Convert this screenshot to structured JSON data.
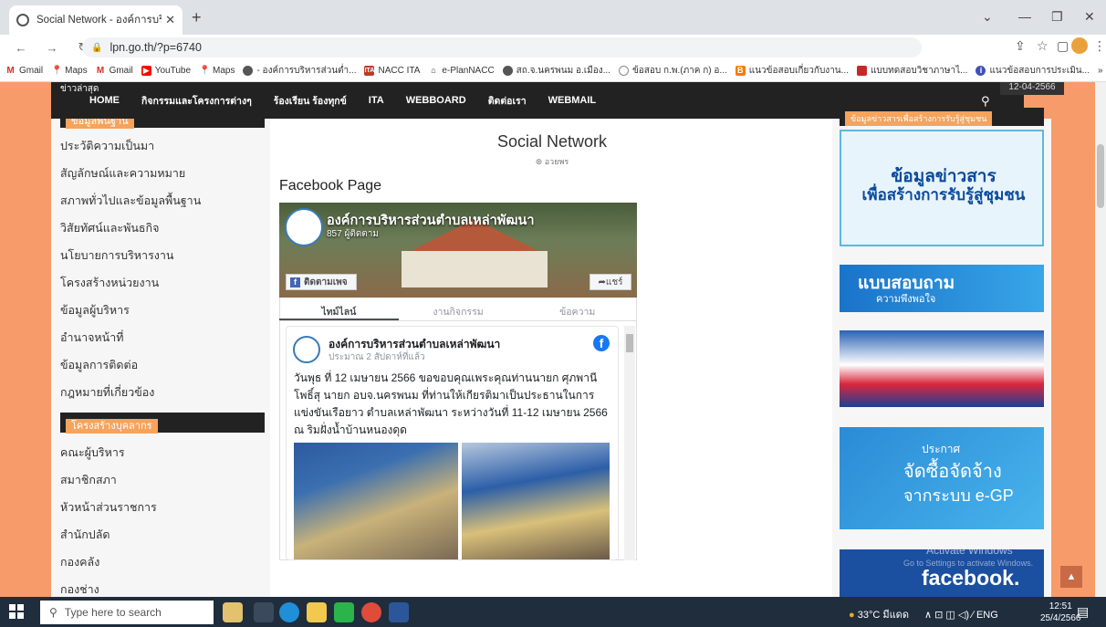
{
  "browser": {
    "tab_title": "Social Network - องค์การบริหารส่วนฯ",
    "url": "lpn.go.th/?p=6740",
    "bookmarks": [
      "Gmail",
      "Maps",
      "Gmail",
      "YouTube",
      "Maps",
      "- องค์การบริหารส่วนต่ำ...",
      "NACC ITA",
      "e-PlanNACC",
      "สถ.จ.นครพนม อ.เมือง...",
      "ข้อสอบ ก.พ.(ภาค ก) อ...",
      "แนวข้อสอบเกี่ยวกับงาน...",
      "แบบทดสอบวิชาภาษาไ...",
      "แนวข้อสอบการประเมิน..."
    ]
  },
  "site": {
    "news_label": "ข่าวล่าสุด",
    "date": "12-04-2566",
    "nav": [
      "HOME",
      "กิจกรรมและโครงการต่างๆ",
      "ร้องเรียน ร้องทุกข์",
      "ITA",
      "WEBBOARD",
      "ติดต่อเรา",
      "WEBMAIL"
    ],
    "left_section1": "ข้อมูลพื้นฐาน",
    "left_items1": [
      "ประวัติความเป็นมา",
      "สัญลักษณ์และความหมาย",
      "สภาพทั่วไปและข้อมูลพื้นฐาน",
      "วิสัยทัศน์และพันธกิจ",
      "นโยบายการบริหารงาน",
      "โครงสร้างหน่วยงาน",
      "ข้อมูลผู้บริหาร",
      "อำนาจหน้าที่",
      "ข้อมูลการติดต่อ",
      "กฎหมายที่เกี่ยวข้อง"
    ],
    "left_section2": "โครงสร้างบุคลากร",
    "left_items2": [
      "คณะผู้บริหาร",
      "สมาชิกสภา",
      "หัวหน้าส่วนราชการ",
      "สำนักปลัด",
      "กองคลัง",
      "กองช่าง"
    ],
    "page_title": "Social Network",
    "author": "อวยพร",
    "fb_heading": "Facebook Page",
    "right_heading": "ข้อมูลข่าวสารเพื่อสร้างการรับรู้สู่ชุมชน"
  },
  "fb": {
    "page_name": "องค์การบริหารส่วนตำบลเหล่าพัฒนา",
    "followers": "857 ผู้ติดตาม",
    "follow_label": "ติดตามเพจ",
    "share_label": "แชร์",
    "tabs": [
      "ไทม์ไลน์",
      "งานกิจกรรม",
      "ข้อความ"
    ],
    "post_author": "องค์การบริหารส่วนตำบลเหล่าพัฒนา",
    "post_time": "ประมาณ 2 สัปดาห์ที่แล้ว",
    "post_text": "วันพุธ ที่ 12 เมษายน 2566 ขอขอบคุณเพระคุณท่านนายก ศุภพานี โพธิ์สุ นายก อบจ.นครพนม ที่ท่านให้เกียรติมาเป็นประธานในการแข่งขันเรือยาว ตำบลเหล่าพัฒนา ระหว่างวันที่ 11-12 เมษายน 2566 ณ ริมฝั่งน้ำบ้านหนองดุด"
  },
  "banners": {
    "b1_line1": "ข้อมูลข่าวสาร",
    "b1_line2": "เพื่อสร้างการรับรู้สู่ชุมชน",
    "b2_line1": "แบบสอบถาม",
    "b2_line2": "ความพึงพอใจ",
    "b4_line1": "ประกาศ",
    "b4_line2": "จัดซื้อจัดจ้าง",
    "b4_line3": "จากระบบ e-GP",
    "b5_text": "facebook.",
    "watermark1": "Activate Windows",
    "watermark2": "Go to Settings to activate Windows."
  },
  "taskbar": {
    "search_placeholder": "Type here to search",
    "weather": "33°C มีแดด",
    "lang": "ENG",
    "time": "12:51",
    "date": "25/4/2566"
  }
}
